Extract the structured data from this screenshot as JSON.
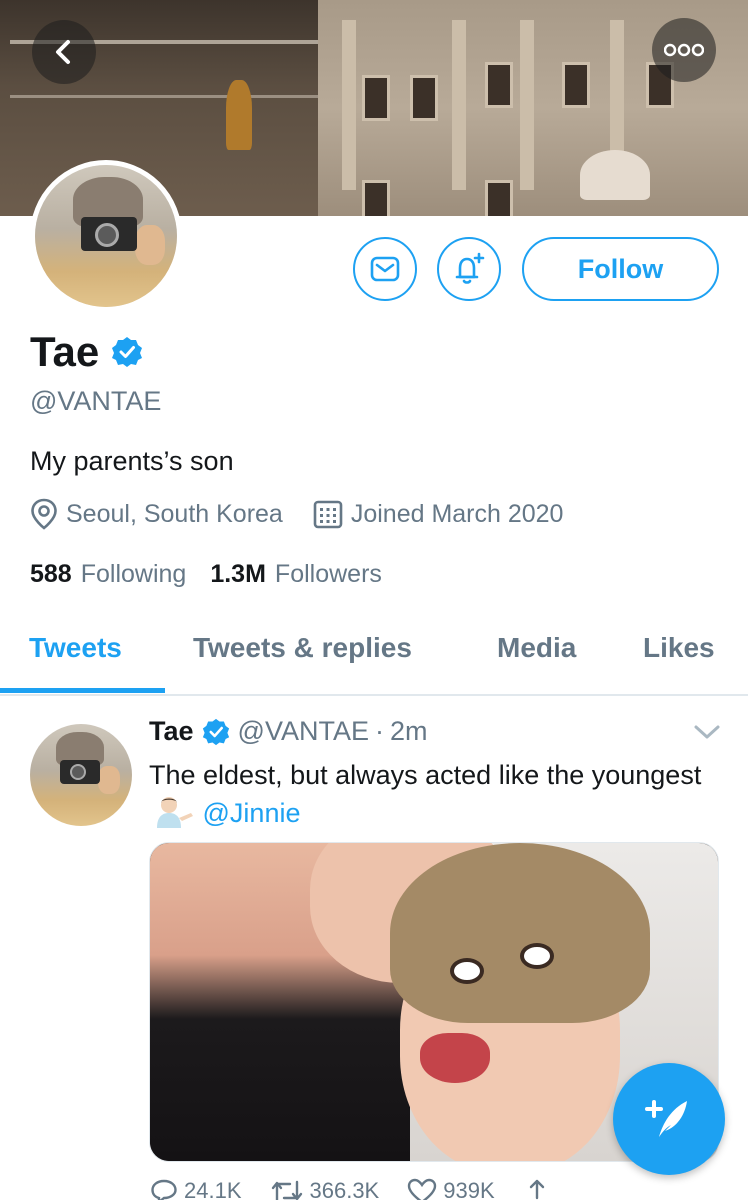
{
  "profile": {
    "name": "Tae",
    "handle": "@VANTAE",
    "bio": "My parents’s son",
    "location": "Seoul, South Korea",
    "joined": "Joined March 2020",
    "following_count": "588",
    "following_label": "Following",
    "followers_count": "1.3M",
    "followers_label": "Followers",
    "verified": true
  },
  "header": {
    "back_icon": "chevron-left-icon",
    "more_icon": "more-dots-icon"
  },
  "actions": {
    "message_icon": "mail-icon",
    "notify_icon": "bell-plus-icon",
    "follow_label": "Follow"
  },
  "tabs": [
    {
      "label": "Tweets",
      "active": true
    },
    {
      "label": "Tweets & replies",
      "active": false
    },
    {
      "label": "Media",
      "active": false
    },
    {
      "label": "Likes",
      "active": false
    }
  ],
  "tweet": {
    "name": "Tae",
    "handle": "@VANTAE",
    "separator": "·",
    "time": "2m",
    "text_part1": "The eldest, but always acted like the youngest",
    "mention": "@Jinnie",
    "reply_count": "24.1K",
    "retweet_count": "366.3K",
    "like_count": "939K"
  },
  "colors": {
    "accent": "#1da1f2",
    "text_primary": "#14171a",
    "text_secondary": "#657786"
  },
  "fab": {
    "icon": "compose-tweet-icon"
  }
}
